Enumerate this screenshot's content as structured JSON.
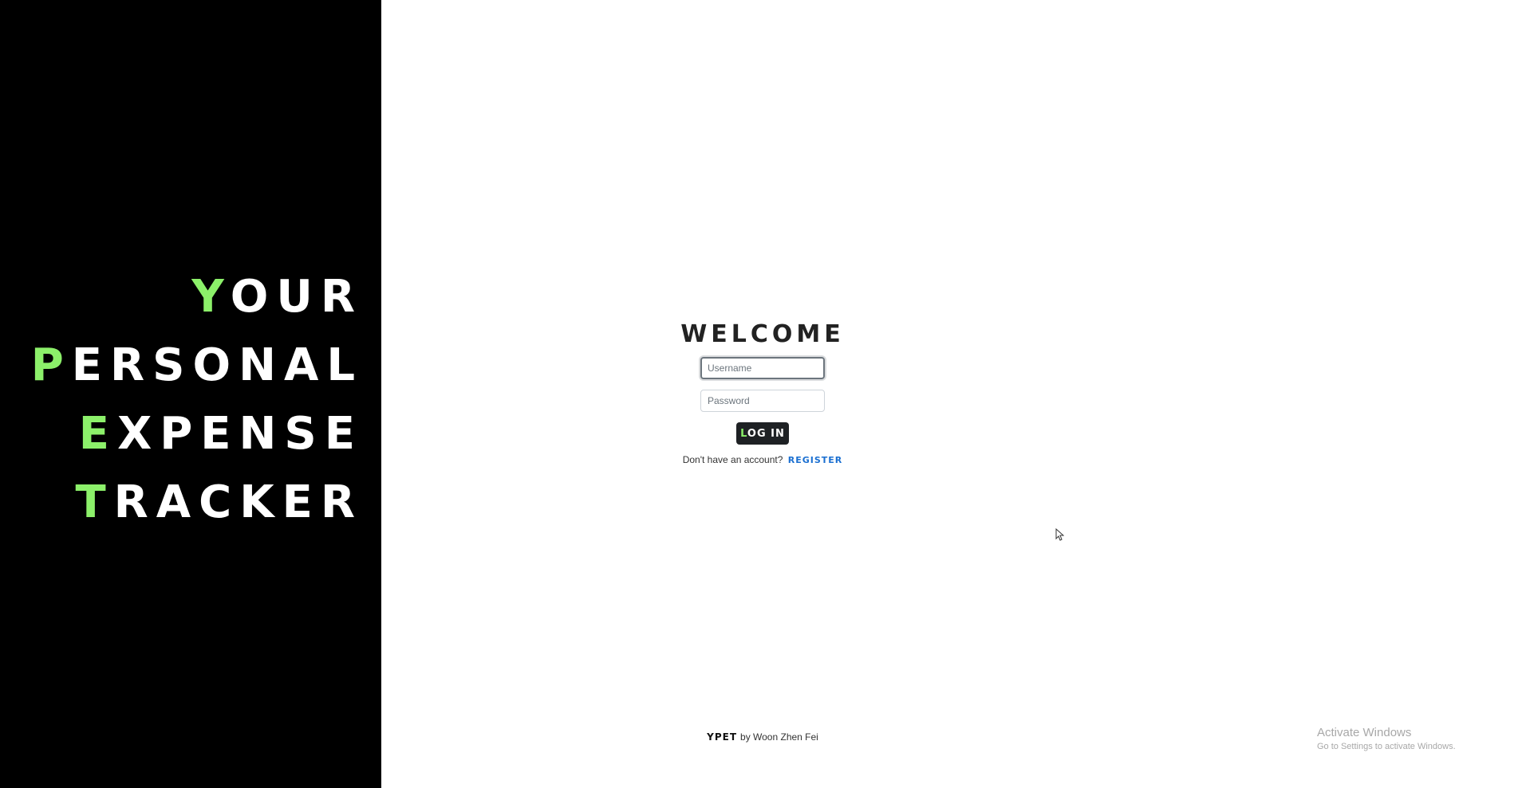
{
  "hero": {
    "lines": [
      {
        "first": "Y",
        "rest": "OUR"
      },
      {
        "first": "P",
        "rest": "ERSONAL"
      },
      {
        "first": "E",
        "rest": "XPENSE"
      },
      {
        "first": "T",
        "rest": "RACKER"
      }
    ],
    "accent_color": "#8cf06a",
    "background": "#000000"
  },
  "login": {
    "title": "WELCOME",
    "username_placeholder": "Username",
    "username_value": "",
    "password_placeholder": "Password",
    "password_value": "",
    "button": {
      "first": "L",
      "rest": "OG IN"
    },
    "register_prompt": "Don't have an account?",
    "register_link": "REGISTER",
    "link_color": "#1a6fd1"
  },
  "footer": {
    "brand": "YPET",
    "credit": "by Woon Zhen Fei"
  },
  "watermark": {
    "title": "Activate Windows",
    "subtitle": "Go to Settings to activate Windows."
  }
}
